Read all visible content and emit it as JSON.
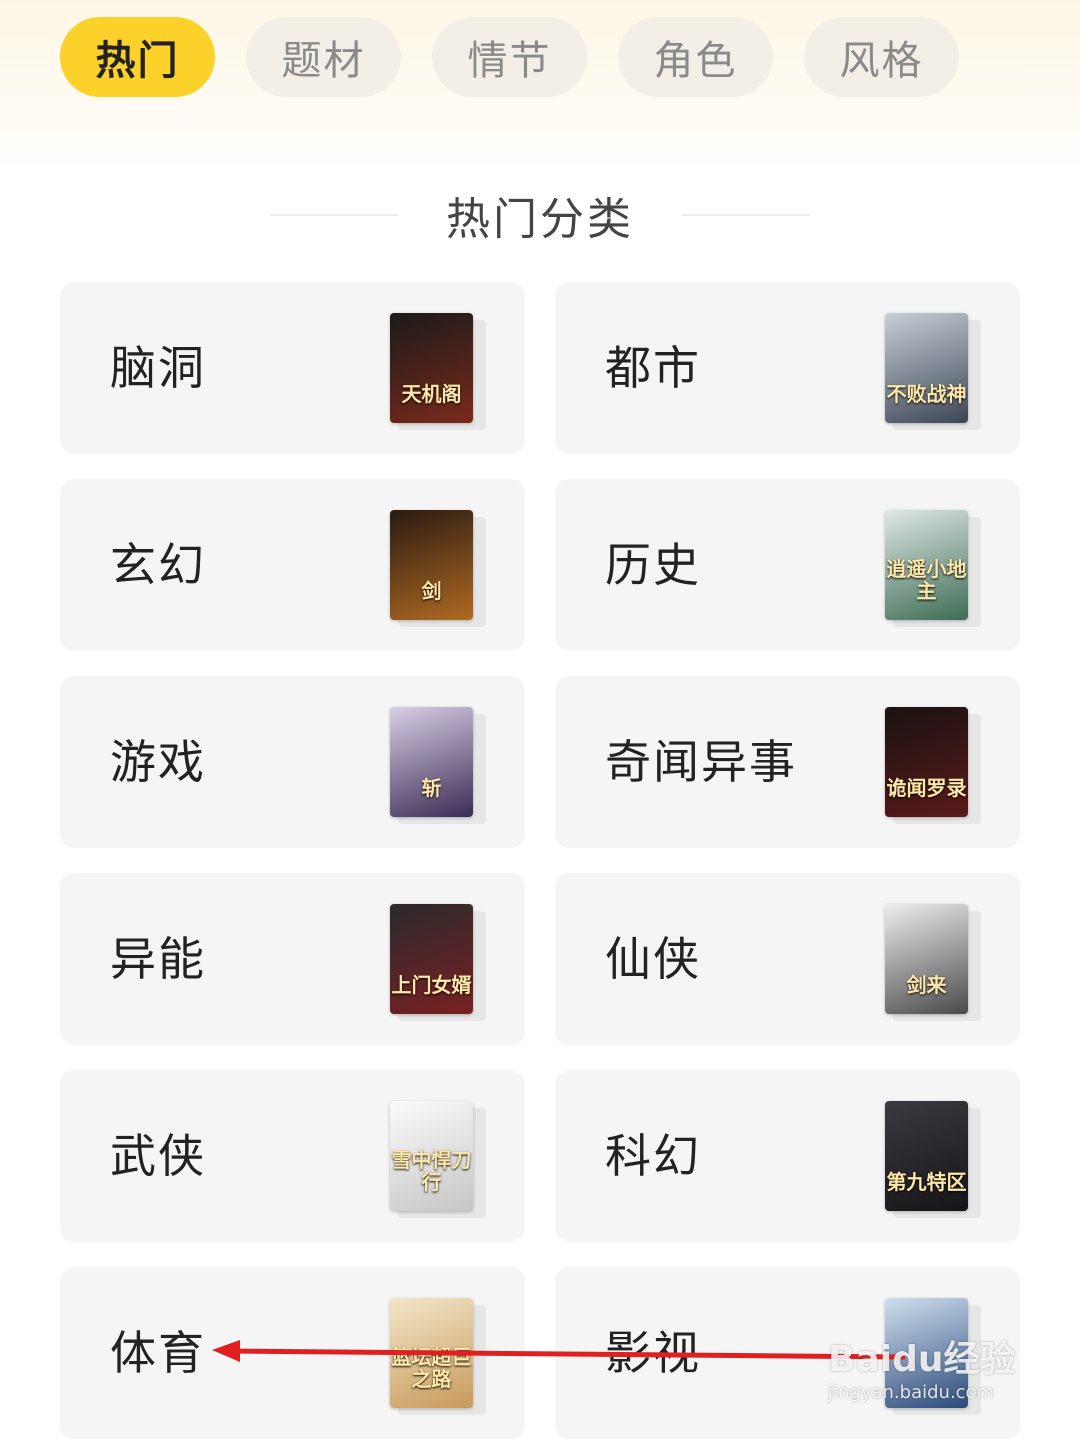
{
  "tabs": [
    {
      "label": "热门",
      "active": true
    },
    {
      "label": "题材",
      "active": false
    },
    {
      "label": "情节",
      "active": false
    },
    {
      "label": "角色",
      "active": false
    },
    {
      "label": "风格",
      "active": false
    }
  ],
  "section_title": "热门分类",
  "categories": [
    {
      "label": "脑洞",
      "cover_title": "天机阁",
      "cover_colors": [
        "#1a1a1a",
        "#7a2a1a"
      ]
    },
    {
      "label": "都市",
      "cover_title": "不败战神",
      "cover_colors": [
        "#c9cfd8",
        "#3b4656"
      ]
    },
    {
      "label": "玄幻",
      "cover_title": "剑",
      "cover_colors": [
        "#2a1a12",
        "#b06a22"
      ]
    },
    {
      "label": "历史",
      "cover_title": "逍遥小地主",
      "cover_colors": [
        "#dfe8e6",
        "#3e6c55"
      ]
    },
    {
      "label": "游戏",
      "cover_title": "斩",
      "cover_colors": [
        "#d9cfe6",
        "#3b2c55"
      ]
    },
    {
      "label": "奇闻异事",
      "cover_title": "诡闻罗录",
      "cover_colors": [
        "#1a1212",
        "#5a1a1a"
      ]
    },
    {
      "label": "异能",
      "cover_title": "上门女婿",
      "cover_colors": [
        "#2a2a2e",
        "#7a2020"
      ]
    },
    {
      "label": "仙侠",
      "cover_title": "剑来",
      "cover_colors": [
        "#eeeeee",
        "#4a4a4a"
      ]
    },
    {
      "label": "武侠",
      "cover_title": "雪中悍刀行",
      "cover_colors": [
        "#fbfbfb",
        "#c6c6c6"
      ]
    },
    {
      "label": "科幻",
      "cover_title": "第九特区",
      "cover_colors": [
        "#3a3a40",
        "#151518"
      ]
    },
    {
      "label": "体育",
      "cover_title": "篮坛超巨之路",
      "cover_colors": [
        "#f3e6c9",
        "#c99a5a"
      ]
    },
    {
      "label": "影视",
      "cover_title": "",
      "cover_colors": [
        "#cfe0ef",
        "#2c4a7a"
      ]
    }
  ],
  "annotation_color": "#e02020",
  "watermark": {
    "brand": "Baidu经验",
    "url": "jingyan.baidu.com"
  }
}
